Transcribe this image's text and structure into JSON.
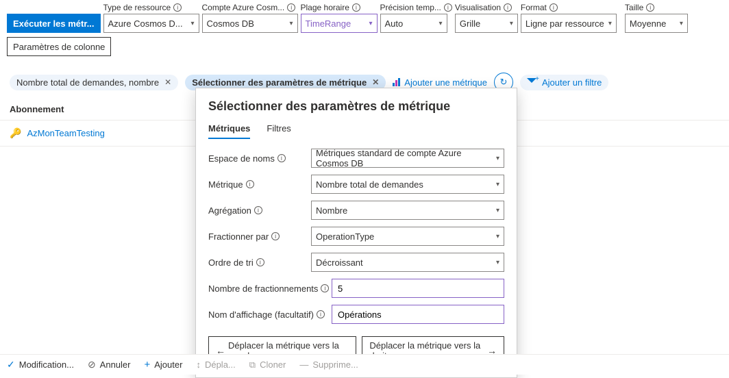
{
  "toolbar": {
    "run_btn": "Exécuter les métr...",
    "col_btn": "Paramètres de colonne",
    "cols": {
      "resourceType": {
        "label": "Type de ressource",
        "value": "Azure Cosmos D..."
      },
      "account": {
        "label": "Compte Azure Cosm...",
        "value": "Cosmos DB"
      },
      "timeRange": {
        "label": "Plage horaire",
        "value": "TimeRange"
      },
      "timeGrain": {
        "label": "Précision temp...",
        "value": "Auto"
      },
      "visualization": {
        "label": "Visualisation",
        "value": "Grille"
      },
      "format": {
        "label": "Format",
        "value": "Ligne par ressource"
      },
      "size": {
        "label": "Taille",
        "value": "Moyenne"
      }
    }
  },
  "pills": {
    "metric1": "Nombre total de demandes, nombre",
    "selector": "Sélectionner des paramètres de métrique",
    "addMetric": "Ajouter une métrique",
    "addFilter": "Ajouter un filtre"
  },
  "list": {
    "header": "Abonnement",
    "item1": "AzMonTeamTesting"
  },
  "popup": {
    "title": "Sélectionner des paramètres de métrique",
    "tab_metrics": "Métriques",
    "tab_filters": "Filtres",
    "rows": {
      "namespace": {
        "label": "Espace de noms",
        "value": "Métriques standard de compte Azure Cosmos DB"
      },
      "metric": {
        "label": "Métrique",
        "value": "Nombre total de demandes"
      },
      "aggregation": {
        "label": "Agrégation",
        "value": "Nombre"
      },
      "splitBy": {
        "label": "Fractionner par",
        "value": "OperationType"
      },
      "sortOrder": {
        "label": "Ordre de tri",
        "value": "Décroissant"
      },
      "splitCount": {
        "label": "Nombre de fractionnements",
        "value": "5"
      },
      "displayName": {
        "label": "Nom d'affichage (facultatif)",
        "value": "Opérations"
      }
    },
    "moveLeft": "Déplacer la métrique vers la gauche",
    "moveRight": "Déplacer la métrique vers la droite"
  },
  "footer": {
    "done": "Modification...",
    "cancel": "Annuler",
    "add": "Ajouter",
    "move": "Dépla...",
    "clone": "Cloner",
    "delete": "Supprime..."
  }
}
